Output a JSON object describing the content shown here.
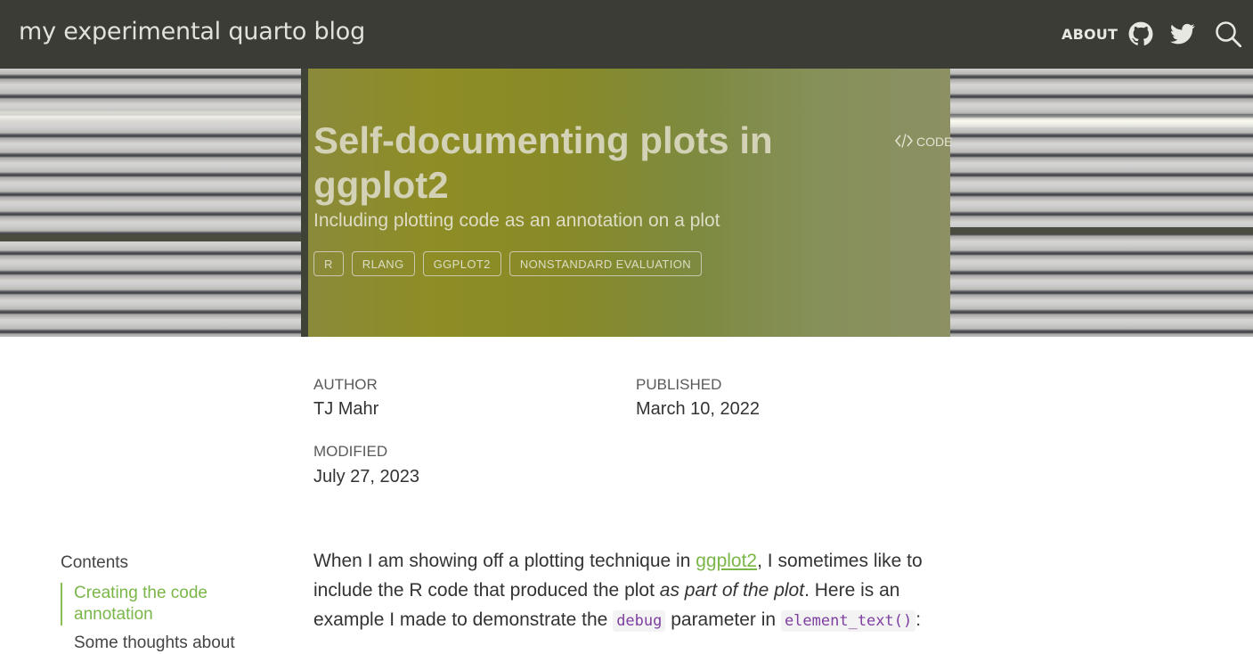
{
  "navbar": {
    "brand": "my experimental quarto blog",
    "about_label": "ABOUT",
    "icons": [
      "github-icon",
      "twitter-icon",
      "search-icon"
    ]
  },
  "hero": {
    "title": "Self-documenting plots in ggplot2",
    "subtitle": "Including plotting code as an annotation on a plot",
    "tags": [
      "R",
      "RLANG",
      "GGPLOT2",
      "NONSTANDARD EVALUATION"
    ],
    "code_label": "CODE"
  },
  "meta": {
    "author_label": "AUTHOR",
    "author": "TJ Mahr",
    "published_label": "PUBLISHED",
    "published": "March 10, 2022",
    "modified_label": "MODIFIED",
    "modified": "July 27, 2023"
  },
  "toc": {
    "title": "Contents",
    "items": [
      "Creating the code annotation",
      "Some thoughts about"
    ]
  },
  "body": {
    "p1_a": "When I am showing off a plotting technique in ",
    "p1_link": "ggplot2",
    "p1_b": ", I sometimes like to include the R code that produced the plot ",
    "p1_em": "as part of the plot",
    "p1_c": ". Here is an example I made to demonstrate the ",
    "p1_code1": "debug",
    "p1_d": " parameter in ",
    "p1_code2": "element_text()",
    "p1_e": ":"
  },
  "colors": {
    "navbar_bg": "#3c3c37",
    "accent_green": "#7ab648",
    "code_purple": "#7d3fa0"
  }
}
